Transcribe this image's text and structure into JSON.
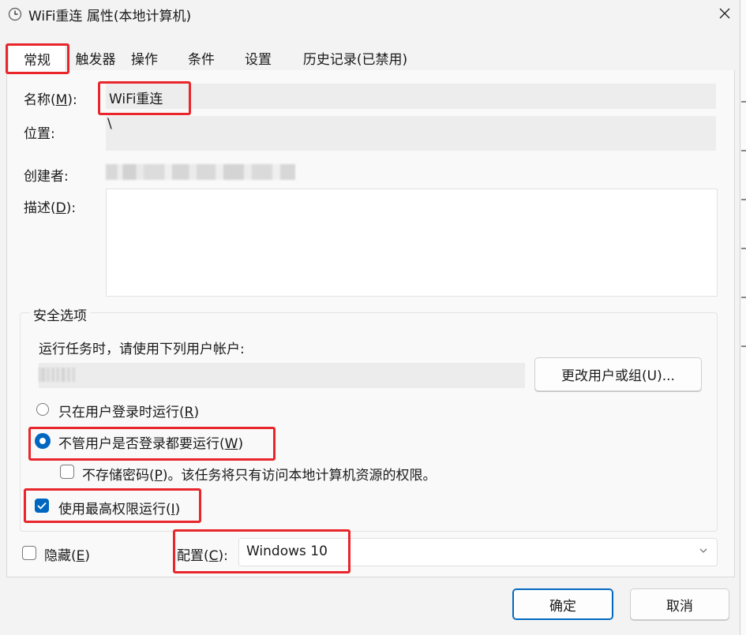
{
  "window": {
    "title": "WiFi重连 属性(本地计算机)"
  },
  "tabs": [
    {
      "label": "常规"
    },
    {
      "label": "触发器"
    },
    {
      "label": "操作"
    },
    {
      "label": "条件"
    },
    {
      "label": "设置"
    },
    {
      "label": "历史记录(已禁用)"
    }
  ],
  "general": {
    "name_label_pre": "名称(",
    "name_label_key": "M",
    "name_label_post": "):",
    "name_value": "WiFi重连",
    "location_label": "位置:",
    "location_value": "\\",
    "author_label": "创建者:",
    "desc_label_pre": "描述(",
    "desc_label_key": "D",
    "desc_label_post": "):"
  },
  "security": {
    "title": "安全选项",
    "run_as_text": "运行任务时，请使用下列用户帐户:",
    "change_user_button": "更改用户或组(U)...",
    "option_logged_on_pre": "只在用户登录时运行(",
    "option_logged_on_key": "R",
    "option_logged_on_post": ")",
    "option_always_pre": "不管用户是否登录都要运行(",
    "option_always_key": "W",
    "option_always_post": ")",
    "no_store_password_pre": "不存储密码(",
    "no_store_password_key": "P",
    "no_store_password_post": ")。该任务将只有访问本地计算机资源的权限。",
    "highest_privileges_pre": "使用最高权限运行(",
    "highest_privileges_key": "I",
    "highest_privileges_post": ")"
  },
  "bottom": {
    "hidden_label_pre": "隐藏(",
    "hidden_label_key": "E",
    "hidden_label_post": ")",
    "config_label_pre": "配置(",
    "config_label_key": "C",
    "config_label_post": "):",
    "config_value": "Windows 10",
    "ok_button": "确定",
    "cancel_button": "取消"
  },
  "colors": {
    "accent": "#0067c0",
    "highlight_box": "#e8262b"
  }
}
